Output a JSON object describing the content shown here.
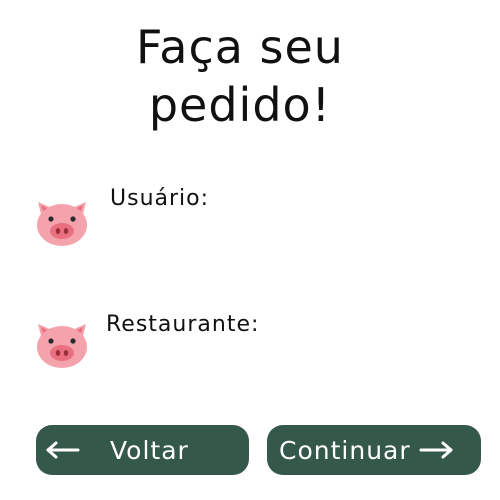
{
  "page": {
    "title_line1": "Faça seu",
    "title_line2": "pedido!"
  },
  "form": {
    "user_label": "Usuário:",
    "restaurant_label": "Restaurante:"
  },
  "buttons": {
    "back_label": "Voltar",
    "continue_label": "Continuar"
  },
  "icons": {
    "field_icon": "pig-face-icon",
    "back_icon": "arrow-left-icon",
    "continue_icon": "arrow-right-icon"
  },
  "colors": {
    "button_bg": "#34594a",
    "button_text": "#ffffff",
    "pig_face": "#f4a3ad",
    "pig_snout": "#e8707f"
  }
}
